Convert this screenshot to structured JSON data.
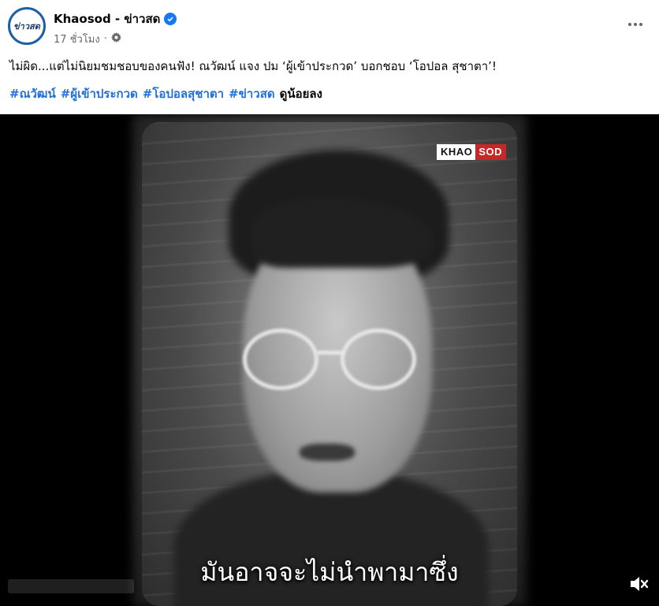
{
  "post": {
    "page_name": "Khaosod - ข่าวสด",
    "avatar_text": "ข่าวสด",
    "timestamp": "17 ชั่วโมง",
    "separator": "·",
    "caption": "ไม่ผิด...แต่ไม่นิยมชมชอบของคนฟัง! ณวัฒน์ แจง ปม ‘ผู้เข้าประกวด’ บอกชอบ ‘โอปอล สุชาตา’!",
    "hashtags": [
      "#ณวัฒน์",
      "#ผู้เข้าประกวด",
      "#โอปอลสุชาตา",
      "#ข่าวสด"
    ],
    "see_less": "ดูน้อยลง"
  },
  "video": {
    "logo_left": "KHAO",
    "logo_right": "SOD",
    "subtitle": "มันอาจจะไม่นำพามาซึ่ง"
  },
  "icons": {
    "verified": "verified-badge-icon",
    "privacy": "globe-gear-icon",
    "more": "more-options-icon",
    "mute": "speaker-muted-icon"
  },
  "colors": {
    "hashtag": "#216fdb",
    "verified": "#1877f2",
    "logo_red": "#c62828",
    "meta_gray": "#65676b"
  }
}
